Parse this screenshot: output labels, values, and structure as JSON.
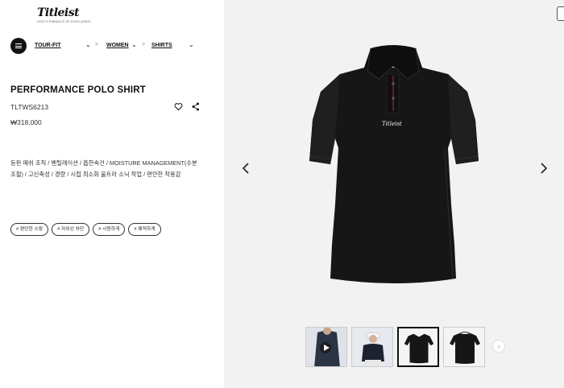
{
  "brand": {
    "logo_text": "Titleist",
    "tagline": "GOLF'S PINNACLE OF EXCELLENCE"
  },
  "breadcrumb": {
    "items": [
      {
        "label": "TOUR-FIT"
      },
      {
        "label": "WOMEN"
      },
      {
        "label": "SHIRTS"
      }
    ],
    "separator": ">"
  },
  "product": {
    "title": "PERFORMANCE POLO SHIRT",
    "code": "TLTWS6213",
    "price": "₩318,000",
    "description": "등판 메쉬 조직 / 벤틸레이션 / 흡한속건 / MOISTURE MANAGEMENT(수분 조절) / 고신축성 / 경량 / 시접 최소화 울트라 소닉 작업 / 편안한 착용감",
    "tags": [
      "# 편안한 스윙",
      "# 자외선 차단",
      "# 시원하게",
      "# 쾌적하게"
    ]
  },
  "gallery": {
    "thumbnails": [
      {
        "label": "video",
        "active": false
      },
      {
        "label": "model",
        "active": false
      },
      {
        "label": "front",
        "active": true
      },
      {
        "label": "back",
        "active": false
      }
    ]
  },
  "colors": {
    "shirt": "#161616",
    "accent": "#7a1e24",
    "panel_bg": "#f2f2f2"
  }
}
